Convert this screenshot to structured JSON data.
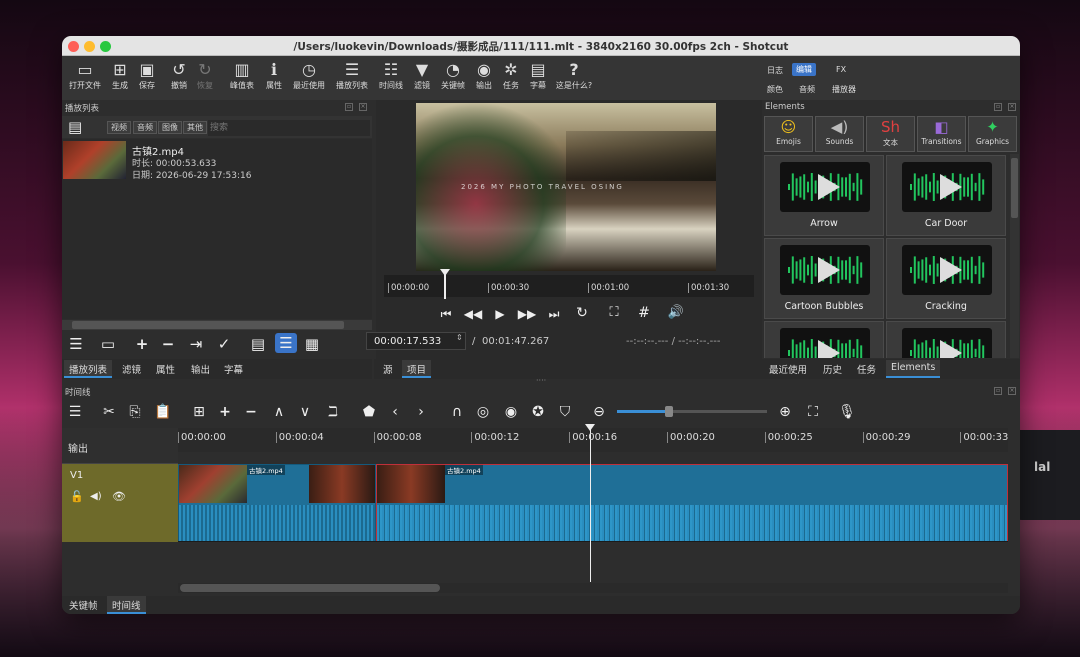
{
  "window": {
    "title": "/Users/luokevin/Downloads/摄影成品/111/111.mlt - 3840x2160 30.00fps 2ch - Shotcut"
  },
  "toolbar": {
    "items": [
      {
        "label": "打开文件",
        "icon": "folder-open-icon",
        "enabled": true
      },
      {
        "label": "生成",
        "icon": "generate-icon",
        "enabled": true
      },
      {
        "label": "保存",
        "icon": "save-icon",
        "enabled": true
      },
      {
        "label": "撤销",
        "icon": "undo-icon",
        "enabled": true
      },
      {
        "label": "恢复",
        "icon": "redo-icon",
        "enabled": false
      },
      {
        "label": "峰值表",
        "icon": "peak-meter-icon",
        "enabled": true
      },
      {
        "label": "属性",
        "icon": "info-icon",
        "enabled": true
      },
      {
        "label": "最近使用",
        "icon": "clock-icon",
        "enabled": true
      },
      {
        "label": "播放列表",
        "icon": "list-icon",
        "enabled": true
      },
      {
        "label": "时间线",
        "icon": "timeline-icon",
        "enabled": true
      },
      {
        "label": "滤镜",
        "icon": "filter-icon",
        "enabled": true
      },
      {
        "label": "关键帧",
        "icon": "stopwatch-icon",
        "enabled": true
      },
      {
        "label": "输出",
        "icon": "export-icon",
        "enabled": true
      },
      {
        "label": "任务",
        "icon": "gear-icon",
        "enabled": true
      },
      {
        "label": "字幕",
        "icon": "subtitles-icon",
        "enabled": true
      },
      {
        "label": "这是什么?",
        "icon": "question-icon",
        "enabled": true
      }
    ],
    "layout_tabs": {
      "row1": [
        "日志",
        "编辑",
        "FX"
      ],
      "row2": [
        "颜色",
        "音频",
        "播放器"
      ],
      "active": "编辑"
    }
  },
  "playlist": {
    "title": "播放列表",
    "filters": [
      "视频",
      "音频",
      "图像",
      "其他"
    ],
    "search_placeholder": "搜索",
    "item": {
      "name": "古镇2.mp4",
      "duration": "时长: 00:00:53.633",
      "date": "日期:  2026-06-29 17:53:16"
    },
    "bottom_tabs": [
      "播放列表",
      "滤镜",
      "属性",
      "输出",
      "字幕"
    ],
    "active_tab": "播放列表"
  },
  "player": {
    "watermark": "2026  MY PHOTO  TRAVEL  OSING",
    "ruler": [
      "00:00:00",
      "00:00:30",
      "00:01:00",
      "00:01:30"
    ],
    "current_time": "00:00:17.533",
    "separator": "/",
    "total_time": "00:01:47.267",
    "in_out": "--:--:--.---  /  --:--:--.---",
    "tabs": [
      "源",
      "项目"
    ],
    "active_tab": "项目",
    "playhead_fraction": 0.163
  },
  "elements": {
    "title": "Elements",
    "categories": [
      {
        "label": "Emojis",
        "icon": "emoji-icon"
      },
      {
        "label": "Sounds",
        "icon": "speaker-icon"
      },
      {
        "label": "文本",
        "icon": "text-sh-icon"
      },
      {
        "label": "Transitions",
        "icon": "transition-icon"
      },
      {
        "label": "Graphics",
        "icon": "sparkle-icon"
      }
    ],
    "cards": [
      "Arrow",
      "Car Door",
      "Cartoon Bubbles",
      "Cracking",
      "",
      ""
    ],
    "bottom_tabs": [
      "最近使用",
      "历史",
      "任务",
      "Elements"
    ],
    "active_tab": "Elements",
    "wave_color": "#22c55e"
  },
  "timeline": {
    "title": "时间线",
    "ruler": [
      "00:00:00",
      "00:00:04",
      "00:00:08",
      "00:00:12",
      "00:00:16",
      "00:00:20",
      "00:00:25",
      "00:00:29",
      "00:00:33"
    ],
    "output_label": "输出",
    "track_label": "V1",
    "clip_name": "古镇2.mp4",
    "bottom_tabs": [
      "关键帧",
      "时间线"
    ],
    "active_tab": "时间线",
    "selected_color": "#c0303a",
    "track_color": "#6e6a2a",
    "clip_color": "#1f6f97"
  }
}
